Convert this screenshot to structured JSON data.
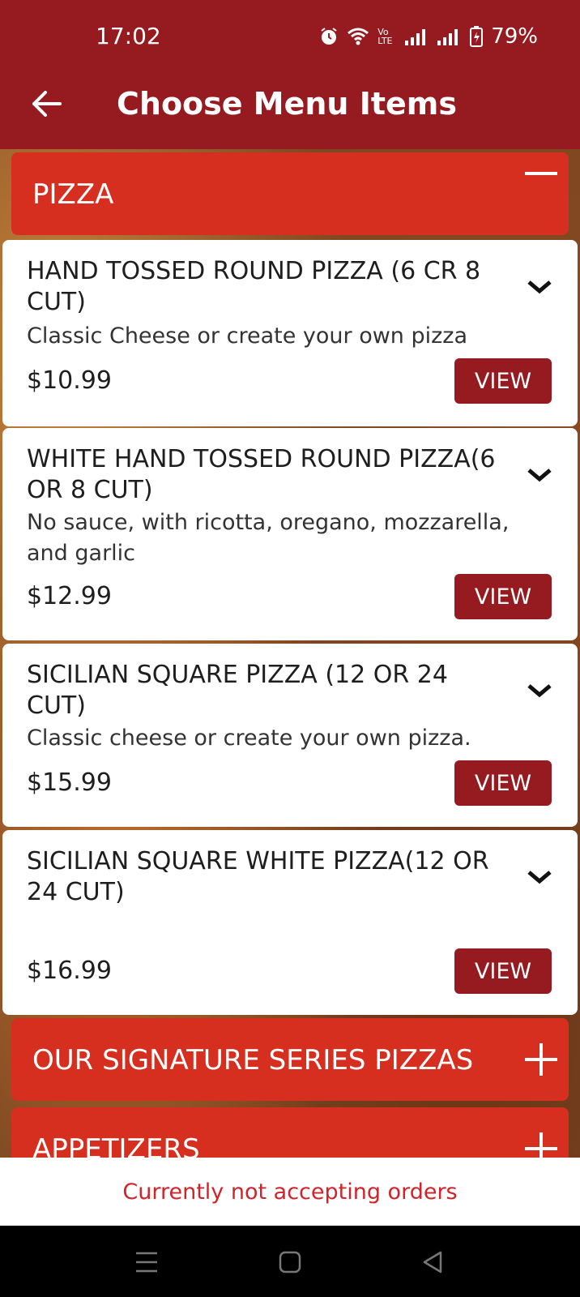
{
  "status_bar": {
    "time": "17:02",
    "network_label": "Vo LTE",
    "battery": "79%"
  },
  "header": {
    "title": "Choose Menu Items"
  },
  "categories": [
    {
      "label": "PIZZA",
      "state": "expanded",
      "icon": "minus-icon"
    },
    {
      "label": "OUR SIGNATURE SERIES PIZZAS",
      "state": "collapsed",
      "icon": "plus-icon"
    },
    {
      "label": "APPETIZERS",
      "state": "collapsed",
      "icon": "plus-icon"
    }
  ],
  "items": [
    {
      "title": "HAND TOSSED ROUND PIZZA (6 CR 8 CUT)",
      "description": "Classic Cheese or create your own pizza",
      "price": "$10.99",
      "button": "VIEW"
    },
    {
      "title": "WHITE HAND TOSSED ROUND PIZZA(6 OR 8 CUT)",
      "description": "No sauce, with ricotta, oregano, mozzarella, and garlic",
      "price": "$12.99",
      "button": "VIEW"
    },
    {
      "title": "SICILIAN SQUARE PIZZA (12 OR 24 CUT)",
      "description": "Classic cheese or create your own pizza.",
      "price": "$15.99",
      "button": "VIEW"
    },
    {
      "title": "SICILIAN SQUARE WHITE PIZZA(12 OR 24 CUT)",
      "description": "",
      "price": "$16.99",
      "button": "VIEW"
    }
  ],
  "notice": "Currently not accepting orders",
  "colors": {
    "header": "#951b20",
    "category": "#d62f1f",
    "button": "#951b20",
    "notice_text": "#d2232a"
  }
}
